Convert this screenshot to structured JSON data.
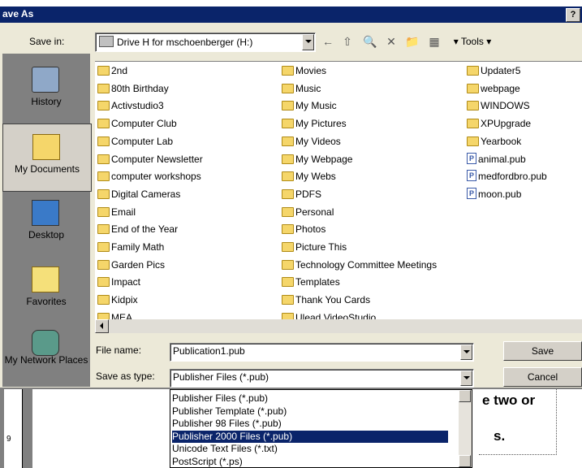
{
  "window": {
    "title": "ave As",
    "help_label": "?"
  },
  "save_in": {
    "label": "Save in:",
    "value": "Drive H for mschoenberger (H:)"
  },
  "toolbar": {
    "back": "←",
    "up": "⇧",
    "search": "🔍",
    "delete": "✕",
    "new_folder": "📁",
    "views": "▦",
    "tools_label": "Tools"
  },
  "places": [
    {
      "label": "History",
      "icon": "history-icon"
    },
    {
      "label": "My Documents",
      "icon": "my-documents-icon"
    },
    {
      "label": "Desktop",
      "icon": "desktop-icon"
    },
    {
      "label": "Favorites",
      "icon": "favorites-icon"
    },
    {
      "label": "My Network Places",
      "icon": "network-places-icon"
    }
  ],
  "files": {
    "col1": [
      "2nd",
      "80th Birthday",
      "Activstudio3",
      "Computer Club",
      "Computer Lab",
      "Computer Newsletter",
      "computer workshops",
      "Digital Cameras",
      "Email",
      "End of the Year",
      "Family Math",
      "Garden Pics",
      "Impact",
      "Kidpix",
      "MEA"
    ],
    "col2": [
      "Movies",
      "Music",
      "My Music",
      "My Pictures",
      "My Videos",
      "My Webpage",
      "My Webs",
      "PDFS",
      "Personal",
      "Photos",
      "Picture This",
      "Technology Committee Meetings",
      "Templates",
      "Thank You Cards",
      "Ulead VideoStudio"
    ],
    "col3": [
      "Updater5",
      "webpage",
      "WINDOWS",
      "XPUpgrade",
      "Yearbook",
      "animal.pub",
      "medfordbro.pub",
      "moon.pub"
    ]
  },
  "file_name": {
    "label": "File name:",
    "value": "Publication1.pub"
  },
  "save_type": {
    "label": "Save as type:",
    "value": "Publisher Files (*.pub)"
  },
  "buttons": {
    "save": "Save",
    "cancel": "Cancel"
  },
  "type_options": [
    "Publisher Files (*.pub)",
    "Publisher Template (*.pub)",
    "Publisher 98 Files (*.pub)",
    "Publisher 2000 Files (*.pub)",
    "Unicode Text Files (*.txt)",
    "PostScript (*.ps)"
  ],
  "selected_option_index": 3,
  "background": {
    "text1": "e two or",
    "text2": "s.",
    "ruler_num": "9"
  },
  "colors": {
    "title_bar": "#0a246a",
    "highlight": "#0a246a",
    "folder": "#f5d66a"
  }
}
